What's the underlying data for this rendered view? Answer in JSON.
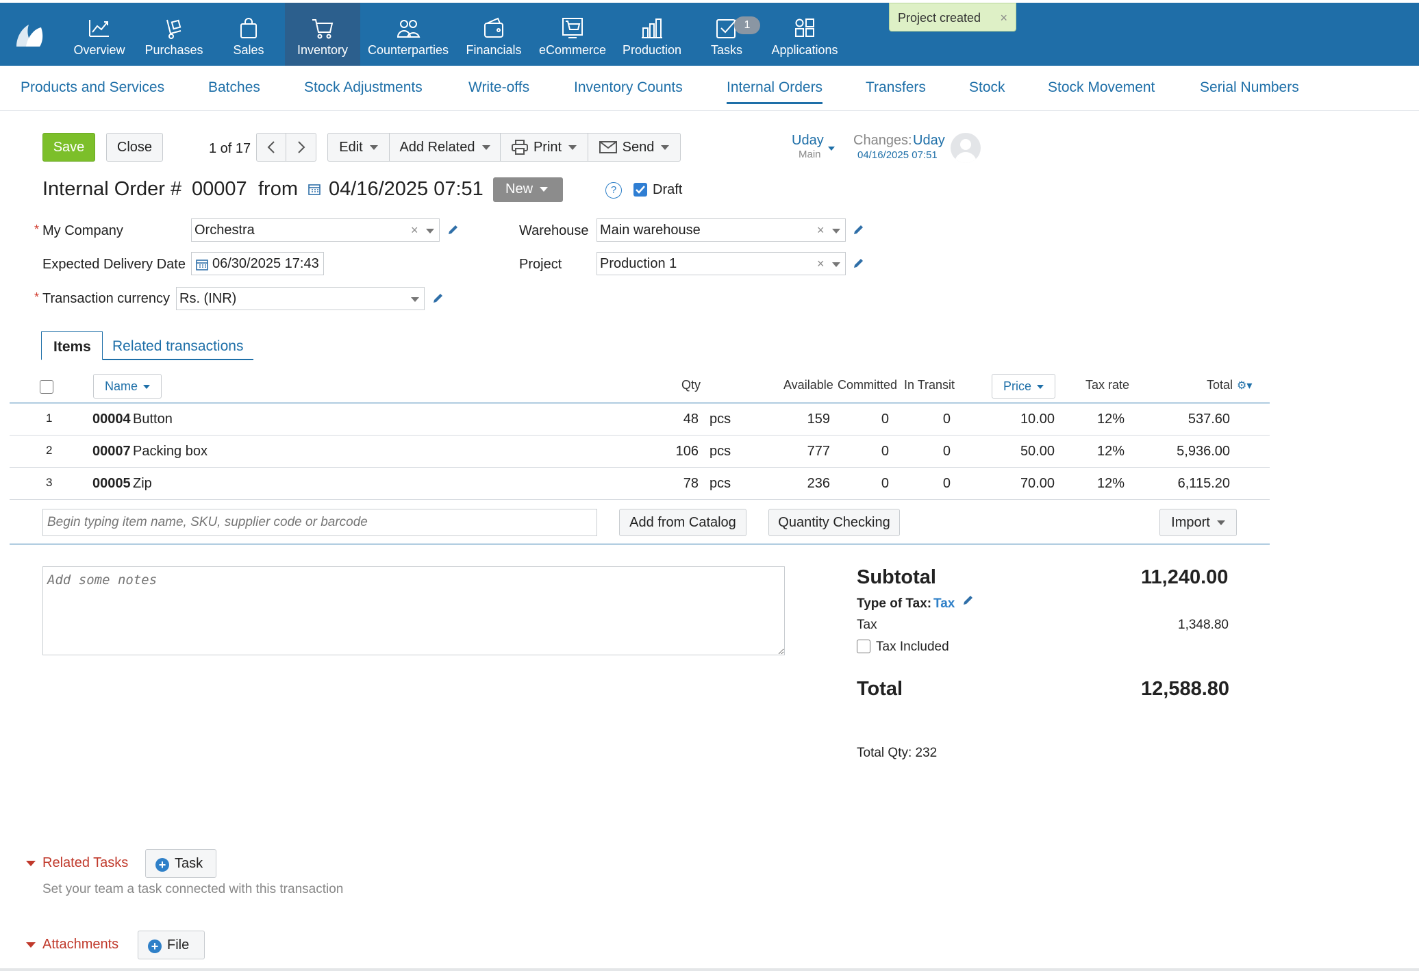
{
  "topnav": {
    "items": [
      {
        "label": "Overview",
        "icon": "chart-line-icon"
      },
      {
        "label": "Purchases",
        "icon": "cart-dolly-icon"
      },
      {
        "label": "Sales",
        "icon": "shopping-bag-icon"
      },
      {
        "label": "Inventory",
        "icon": "cart-icon",
        "active": true
      },
      {
        "label": "Counterparties",
        "icon": "people-icon"
      },
      {
        "label": "Financials",
        "icon": "wallet-icon"
      },
      {
        "label": "eCommerce",
        "icon": "shop-icon"
      },
      {
        "label": "Production",
        "icon": "factory-icon"
      },
      {
        "label": "Tasks",
        "icon": "checkbox-icon",
        "badge": "1"
      },
      {
        "label": "Applications",
        "icon": "apps-icon"
      }
    ],
    "background": "#1f6ea8"
  },
  "toast": {
    "text": "Project created",
    "close": "×"
  },
  "subnav": {
    "items": [
      "Products and Services",
      "Batches",
      "Stock Adjustments",
      "Write-offs",
      "Inventory Counts",
      "Internal Orders",
      "Transfers",
      "Stock",
      "Stock Movement",
      "Serial Numbers"
    ],
    "active": "Internal Orders"
  },
  "toolbar": {
    "save": "Save",
    "close": "Close",
    "pager": "1 of 17",
    "edit": "Edit",
    "add_related": "Add Related",
    "print": "Print",
    "send": "Send"
  },
  "owner": {
    "name": "Uday",
    "group": "Main",
    "changes_label": "Changes:",
    "changes_user": "Uday",
    "changes_time": "04/16/2025 07:51"
  },
  "header": {
    "title": "Internal Order #",
    "number": "00007",
    "from": "from",
    "datetime": "04/16/2025 07:51",
    "status": "New",
    "help": "?",
    "draft_label": "Draft",
    "draft_checked": true
  },
  "form": {
    "my_company_label": "My Company",
    "my_company_value": "Orchestra",
    "warehouse_label": "Warehouse",
    "warehouse_value": "Main warehouse",
    "delivery_label": "Expected Delivery Date",
    "delivery_value": "06/30/2025 17:43",
    "project_label": "Project",
    "project_value": "Production 1",
    "currency_label": "Transaction currency",
    "currency_value": "Rs. (INR)",
    "required_mark": "*",
    "clear": "×"
  },
  "tabs": {
    "items": "Items",
    "related": "Related transactions"
  },
  "table": {
    "headers": {
      "name": "Name",
      "qty": "Qty",
      "available": "Available",
      "committed": "Committed",
      "in_transit": "In Transit",
      "price": "Price",
      "tax_rate": "Tax rate",
      "total": "Total"
    },
    "rows": [
      {
        "n": "1",
        "code": "00004",
        "name": "Button",
        "qty": "48",
        "unit": "pcs",
        "available": "159",
        "committed": "0",
        "in_transit": "0",
        "price": "10.00",
        "tax": "12%",
        "total": "537.60"
      },
      {
        "n": "2",
        "code": "00007",
        "name": "Packing box",
        "qty": "106",
        "unit": "pcs",
        "available": "777",
        "committed": "0",
        "in_transit": "0",
        "price": "50.00",
        "tax": "12%",
        "total": "5,936.00"
      },
      {
        "n": "3",
        "code": "00005",
        "name": "Zip",
        "qty": "78",
        "unit": "pcs",
        "available": "236",
        "committed": "0",
        "in_transit": "0",
        "price": "70.00",
        "tax": "12%",
        "total": "6,115.20"
      }
    ],
    "add_placeholder": "Begin typing item name, SKU, supplier code or barcode",
    "add_from_catalog": "Add from Catalog",
    "quantity_checking": "Quantity Checking",
    "import": "Import"
  },
  "notes": {
    "placeholder": "Add some notes"
  },
  "summary": {
    "subtotal_label": "Subtotal",
    "subtotal": "11,240.00",
    "type_of_tax_label": "Type of Tax:",
    "type_of_tax_value": "Tax",
    "tax_label": "Tax",
    "tax": "1,348.80",
    "tax_included_label": "Tax Included",
    "total_label": "Total",
    "total": "12,588.80",
    "total_qty": "Total Qty: 232"
  },
  "related_tasks": {
    "label": "Related Tasks",
    "button": "Task",
    "hint": "Set your team a task connected with this transaction"
  },
  "attachments": {
    "label": "Attachments",
    "button": "File"
  }
}
